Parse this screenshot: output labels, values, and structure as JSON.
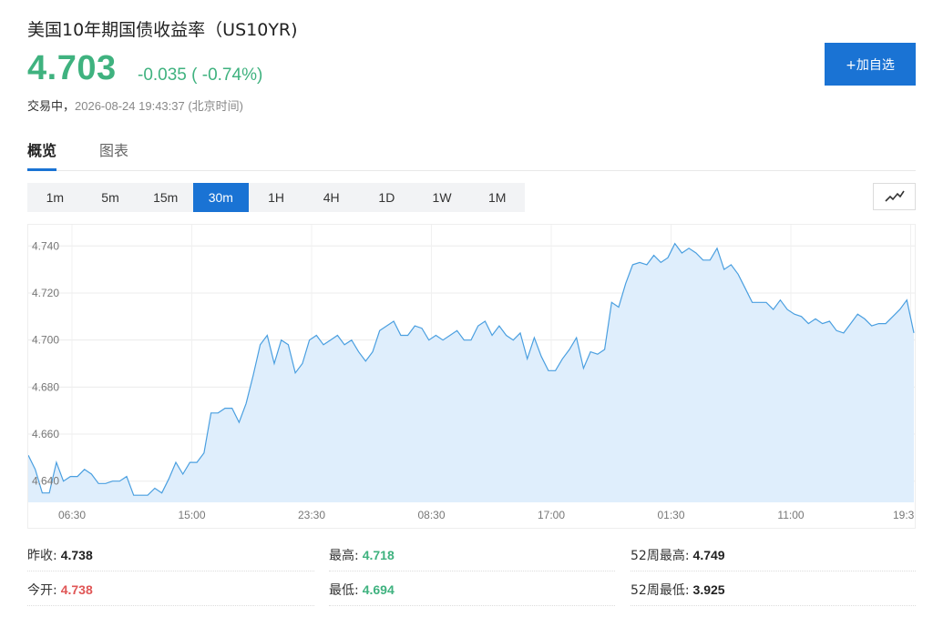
{
  "header": {
    "title": "美国10年期国债收益率（US10YR)",
    "price": "4.703",
    "change": "-0.035 ( -0.74%)",
    "status_label": "交易中，",
    "timestamp": "2026-08-24 19:43:37 (北京时间)",
    "add_button": "+加自选"
  },
  "tabs": [
    {
      "label": "概览",
      "active": true
    },
    {
      "label": "图表",
      "active": false
    }
  ],
  "periods": [
    {
      "label": "1m",
      "active": false
    },
    {
      "label": "5m",
      "active": false
    },
    {
      "label": "15m",
      "active": false
    },
    {
      "label": "30m",
      "active": true
    },
    {
      "label": "1H",
      "active": false
    },
    {
      "label": "4H",
      "active": false
    },
    {
      "label": "1D",
      "active": false
    },
    {
      "label": "1W",
      "active": false
    },
    {
      "label": "1M",
      "active": false
    }
  ],
  "chart_type_icon": "line-chart-icon",
  "chart_data": {
    "type": "area",
    "y_ticks": [
      "4.740",
      "4.720",
      "4.700",
      "4.680",
      "4.660",
      "4.640"
    ],
    "x_ticks": [
      "06:30",
      "15:00",
      "23:30",
      "08:30",
      "17:00",
      "01:30",
      "11:00",
      "19:3"
    ],
    "ylim": [
      4.631,
      4.749
    ],
    "grid": true,
    "line_color": "#4a9fe0",
    "fill_color": "#dfeefc",
    "values": [
      4.651,
      4.645,
      4.635,
      4.635,
      4.648,
      4.64,
      4.642,
      4.642,
      4.645,
      4.643,
      4.639,
      4.639,
      4.64,
      4.64,
      4.642,
      4.634,
      4.634,
      4.634,
      4.637,
      4.635,
      4.641,
      4.648,
      4.643,
      4.648,
      4.648,
      4.652,
      4.669,
      4.669,
      4.671,
      4.671,
      4.665,
      4.673,
      4.685,
      4.698,
      4.702,
      4.69,
      4.7,
      4.698,
      4.686,
      4.69,
      4.7,
      4.702,
      4.698,
      4.7,
      4.702,
      4.698,
      4.7,
      4.695,
      4.691,
      4.695,
      4.704,
      4.706,
      4.708,
      4.702,
      4.702,
      4.706,
      4.705,
      4.7,
      4.702,
      4.7,
      4.702,
      4.704,
      4.7,
      4.7,
      4.706,
      4.708,
      4.702,
      4.706,
      4.702,
      4.7,
      4.703,
      4.692,
      4.701,
      4.693,
      4.687,
      4.687,
      4.692,
      4.696,
      4.701,
      4.688,
      4.695,
      4.694,
      4.696,
      4.716,
      4.714,
      4.724,
      4.732,
      4.733,
      4.732,
      4.736,
      4.733,
      4.735,
      4.741,
      4.737,
      4.739,
      4.737,
      4.734,
      4.734,
      4.739,
      4.73,
      4.732,
      4.728,
      4.722,
      4.716,
      4.716,
      4.716,
      4.713,
      4.717,
      4.713,
      4.711,
      4.71,
      4.707,
      4.709,
      4.707,
      4.708,
      4.704,
      4.703,
      4.707,
      4.711,
      4.709,
      4.706,
      4.707,
      4.707,
      4.71,
      4.713,
      4.717,
      4.703
    ]
  },
  "stats": [
    {
      "label": "昨收:",
      "value": "4.738",
      "tone": "neutral"
    },
    {
      "label": "最高:",
      "value": "4.718",
      "tone": "down"
    },
    {
      "label": "52周最高:",
      "value": "4.749",
      "tone": "neutral"
    },
    {
      "label": "今开:",
      "value": "4.738",
      "tone": "up"
    },
    {
      "label": "最低:",
      "value": "4.694",
      "tone": "down"
    },
    {
      "label": "52周最低:",
      "value": "3.925",
      "tone": "neutral"
    }
  ]
}
